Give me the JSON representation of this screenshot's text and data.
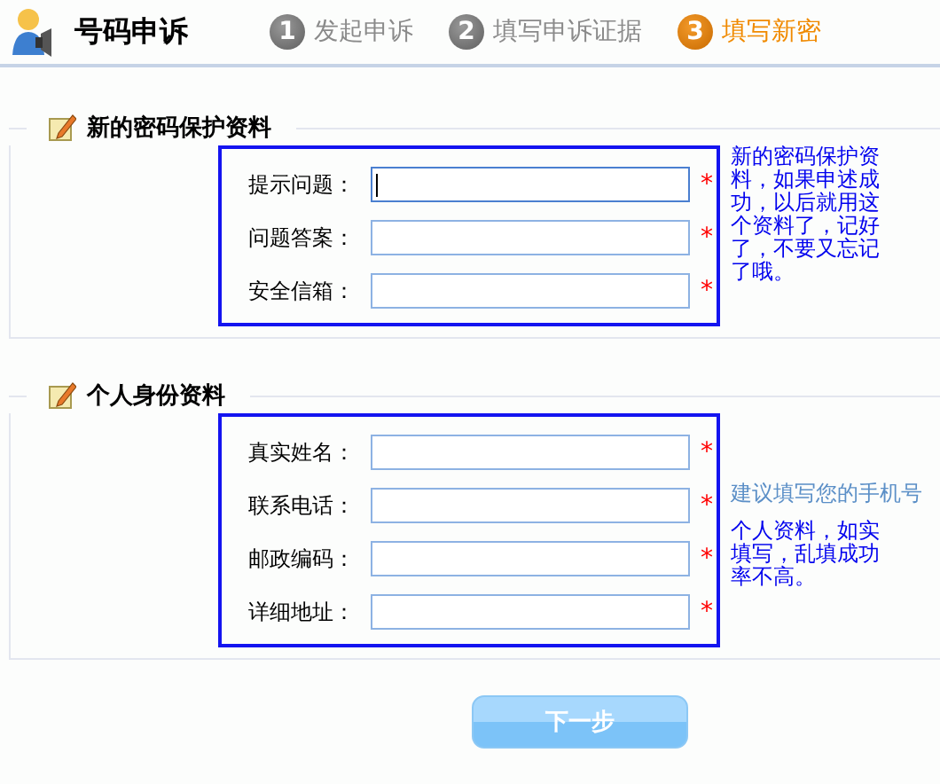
{
  "header": {
    "title": "号码申诉",
    "steps": [
      {
        "number": "1",
        "label": "发起申诉",
        "selected": false
      },
      {
        "number": "2",
        "label": "填写申诉证据",
        "selected": false
      },
      {
        "number": "3",
        "label": "填写新密",
        "selected": true
      }
    ]
  },
  "sections": [
    {
      "title": "新的密码保护资料",
      "note": "新的密码保护资料，如果申述成功，以后就用这个资料了，记好了，不要又忘记了哦。",
      "fields": [
        {
          "label": "提示问题：",
          "required_mark": "*",
          "focused": true
        },
        {
          "label": "问题答案：",
          "required_mark": "*",
          "focused": false
        },
        {
          "label": "安全信箱：",
          "required_mark": "*",
          "focused": false
        }
      ]
    },
    {
      "title": "个人身份资料",
      "note": "个人资料，如实填写，乱填成功率不高。",
      "fields": [
        {
          "label": "真实姓名：",
          "required_mark": "*",
          "focused": false
        },
        {
          "label": "联系电话：",
          "required_mark": "*",
          "focused": false,
          "hint": "建议填写您的手机号"
        },
        {
          "label": "邮政编码：",
          "required_mark": "*",
          "focused": false
        },
        {
          "label": "详细地址：",
          "required_mark": "*",
          "focused": false
        }
      ]
    }
  ],
  "next_button": "下一步"
}
